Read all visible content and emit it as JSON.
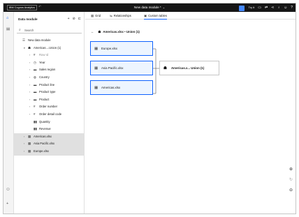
{
  "topbar": {
    "brand": "IBM Cognos Analytics",
    "doc_title": "New data module *",
    "try_it": "Try it"
  },
  "panel": {
    "title": "Data module",
    "search_placeholder": "Search",
    "tree": [
      {
        "label": "New data module",
        "indent": 0,
        "icon": "module-icon",
        "twisty": ""
      },
      {
        "label": "Americas....Union (1)",
        "indent": 1,
        "icon": "union-icon",
        "twisty": "▾"
      },
      {
        "label": "Row Id",
        "indent": 2,
        "icon": "hash-icon",
        "twisty": "›",
        "dim": true
      },
      {
        "label": "Year",
        "indent": 2,
        "icon": "clock-icon",
        "twisty": "›"
      },
      {
        "label": "Sales region",
        "indent": 2,
        "icon": "text-icon",
        "twisty": "›"
      },
      {
        "label": "Country",
        "indent": 2,
        "icon": "globe-icon",
        "twisty": "›"
      },
      {
        "label": "Product line",
        "indent": 2,
        "icon": "text-icon",
        "twisty": "›"
      },
      {
        "label": "Product type",
        "indent": 2,
        "icon": "text-icon",
        "twisty": "›"
      },
      {
        "label": "Product",
        "indent": 2,
        "icon": "text-icon",
        "twisty": "›"
      },
      {
        "label": "Order number",
        "indent": 2,
        "icon": "hash-icon",
        "twisty": "›"
      },
      {
        "label": "Order detail code",
        "indent": 2,
        "icon": "hash-icon",
        "twisty": "›"
      },
      {
        "label": "Quantity",
        "indent": 2,
        "icon": "measure-icon",
        "twisty": ""
      },
      {
        "label": "Revenue",
        "indent": 2,
        "icon": "measure-icon",
        "twisty": ""
      },
      {
        "label": "Americas.xlsx",
        "indent": 1,
        "icon": "table-icon",
        "twisty": "›",
        "sel": true
      },
      {
        "label": "Asia Pacific.xlsx",
        "indent": 1,
        "icon": "table-icon",
        "twisty": "›",
        "sel": true
      },
      {
        "label": "Europe.xlsx",
        "indent": 1,
        "icon": "table-icon",
        "twisty": "›",
        "sel": true
      }
    ]
  },
  "tabs": [
    {
      "label": "Grid",
      "icon": "grid-icon",
      "active": false
    },
    {
      "label": "Relationships",
      "icon": "relationships-icon",
      "active": false
    },
    {
      "label": "Custom tables",
      "icon": "custom-tables-icon",
      "active": true
    }
  ],
  "breadcrumb": {
    "label": "Americas.xlsx • Union (1)"
  },
  "canvas": {
    "sources": [
      "Europe.xlsx",
      "Asia Pacific.xlsx",
      "Americas.xlsx"
    ],
    "result": "Americas.x... Union (1)"
  },
  "colors": {
    "accent": "#0f62fe",
    "topbar": "#161616",
    "node_fill": "#edf5ff"
  }
}
